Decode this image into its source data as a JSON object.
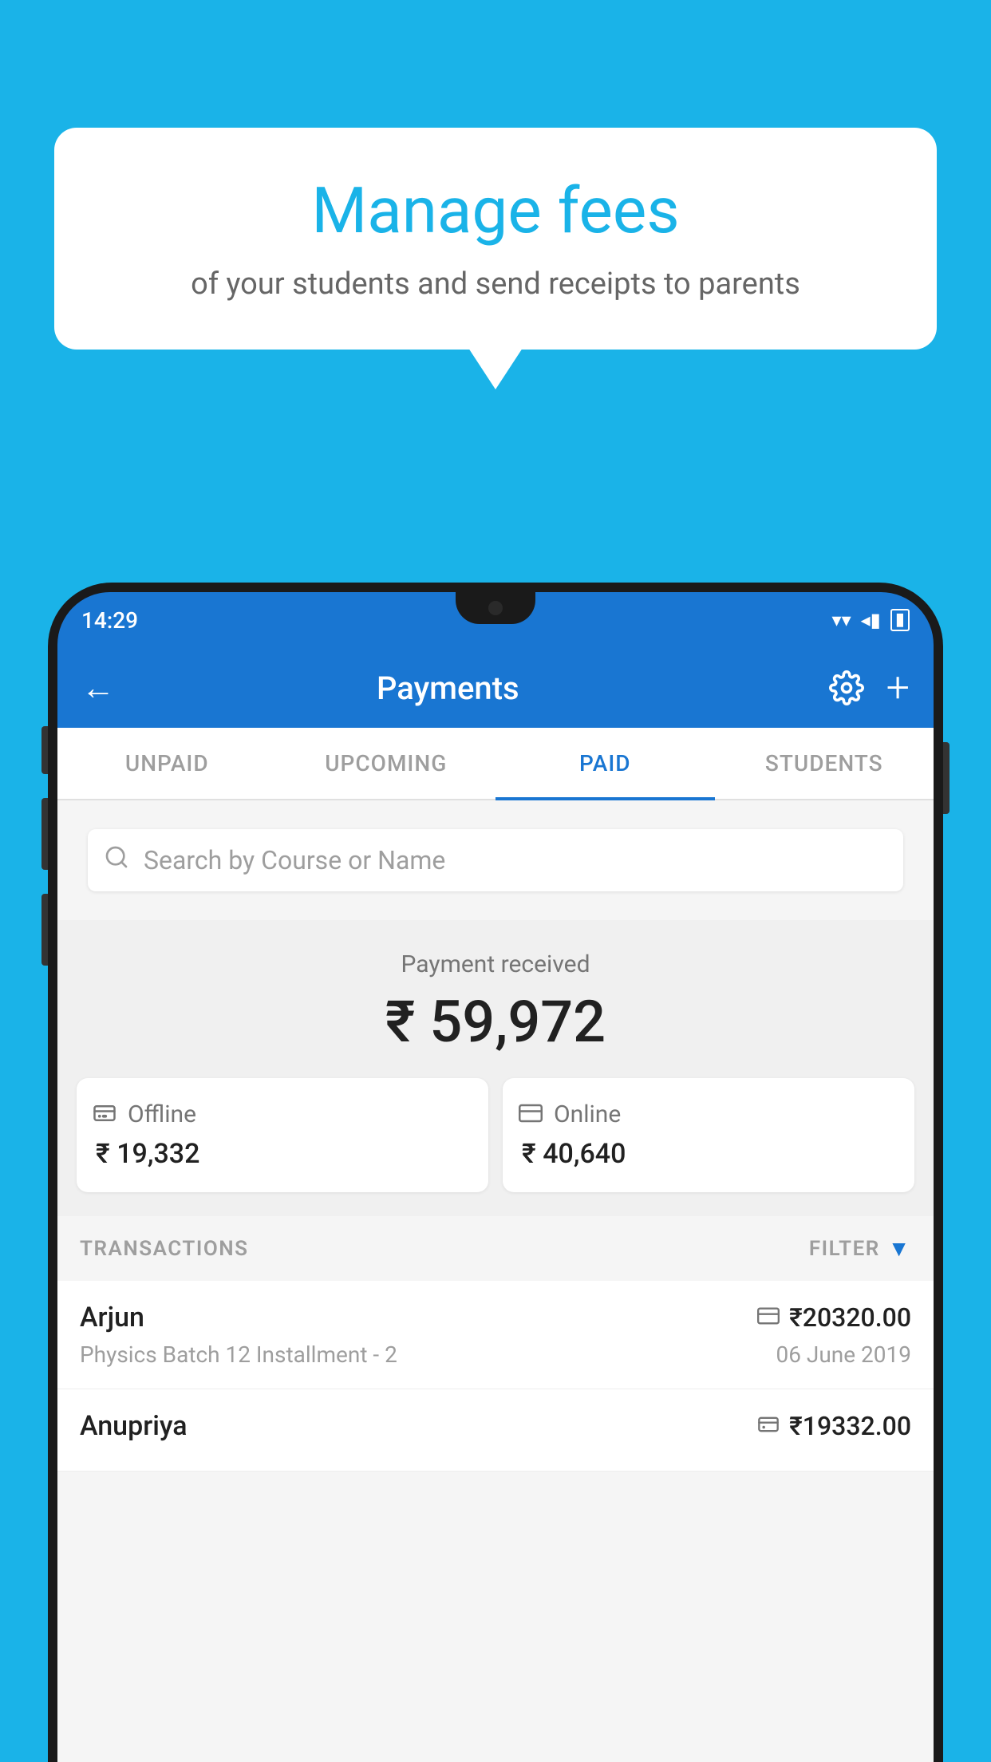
{
  "background_color": "#1ab3e8",
  "bubble": {
    "title": "Manage fees",
    "subtitle": "of your students and send receipts to parents"
  },
  "status_bar": {
    "time": "14:29",
    "wifi": "▾",
    "signal": "◂",
    "battery": "▮"
  },
  "header": {
    "title": "Payments",
    "back_label": "←",
    "plus_label": "+"
  },
  "tabs": [
    {
      "label": "UNPAID",
      "active": false
    },
    {
      "label": "UPCOMING",
      "active": false
    },
    {
      "label": "PAID",
      "active": true
    },
    {
      "label": "STUDENTS",
      "active": false
    }
  ],
  "search": {
    "placeholder": "Search by Course or Name"
  },
  "payment_section": {
    "label": "Payment received",
    "total_amount": "₹ 59,972",
    "offline": {
      "type": "Offline",
      "amount": "₹ 19,332",
      "icon": "offline-icon"
    },
    "online": {
      "type": "Online",
      "amount": "₹ 40,640",
      "icon": "card-icon"
    }
  },
  "transactions": {
    "label": "TRANSACTIONS",
    "filter_label": "FILTER",
    "items": [
      {
        "name": "Arjun",
        "amount": "₹20320.00",
        "course": "Physics Batch 12 Installment - 2",
        "date": "06 June 2019",
        "payment_type": "online"
      },
      {
        "name": "Anupriya",
        "amount": "₹19332.00",
        "course": "",
        "date": "",
        "payment_type": "offline"
      }
    ]
  }
}
